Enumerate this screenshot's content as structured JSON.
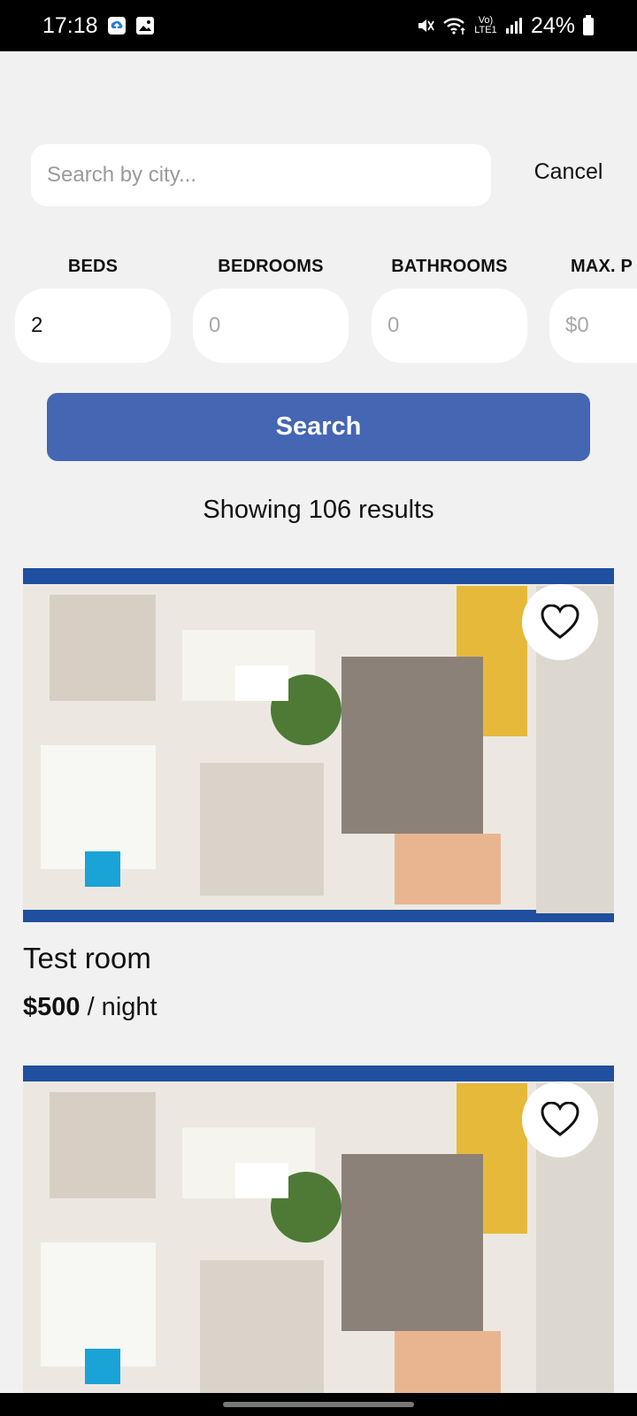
{
  "status_bar": {
    "time": "17:18",
    "battery": "24%",
    "network_label": "Vo) LTE1"
  },
  "search": {
    "placeholder": "Search by city...",
    "value": "",
    "cancel_label": "Cancel"
  },
  "filters": [
    {
      "label": "BEDS",
      "value": "2",
      "placeholder": "0"
    },
    {
      "label": "BEDROOMS",
      "value": "",
      "placeholder": "0"
    },
    {
      "label": "BATHROOMS",
      "value": "",
      "placeholder": "0"
    },
    {
      "label": "MAX. P",
      "value": "",
      "placeholder": "$0"
    }
  ],
  "search_button_label": "Search",
  "results_text": "Showing 106 results",
  "listings": [
    {
      "title": "Test room",
      "price": "$500",
      "unit": " / night"
    },
    {
      "title": "",
      "price": "",
      "unit": ""
    }
  ],
  "colors": {
    "accent": "#4466b3",
    "background": "#f1f1f1"
  }
}
